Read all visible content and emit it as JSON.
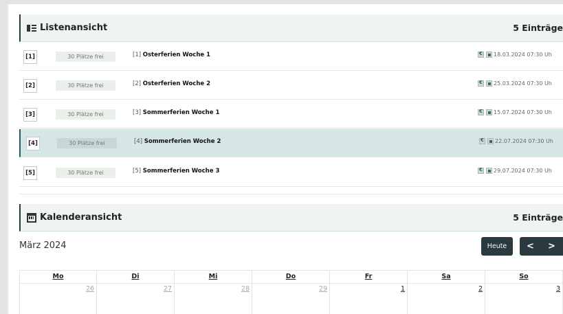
{
  "list_section": {
    "title": "Listenansicht",
    "count": "5 Einträge",
    "rows": [
      {
        "idx": "[1]",
        "places": "30 Plätze frei",
        "num": "[1]",
        "title": "Osterferien Woche 1",
        "date": "18.03.2024 07:30 Uh"
      },
      {
        "idx": "[2]",
        "places": "30 Plätze frei",
        "num": "[2]",
        "title": "Osterferien Woche 2",
        "date": "25.03.2024 07:30 Uh"
      },
      {
        "idx": "[3]",
        "places": "30 Plätze frei",
        "num": "[3]",
        "title": "Sommerferien Woche 1",
        "date": "15.07.2024 07:30 Uh"
      },
      {
        "idx": "[4]",
        "places": "30 Plätze frei",
        "num": "[4]",
        "title": "Sommerferien Woche 2",
        "date": "22.07.2024 07:30 Uh"
      },
      {
        "idx": "[5]",
        "places": "30 Plätze frei",
        "num": "[5]",
        "title": "Sommerferien Woche 3",
        "date": "29.07.2024 07:30 Uh"
      }
    ]
  },
  "calendar_section": {
    "title": "Kalenderansicht",
    "count": "5 Einträge",
    "month": "März 2024",
    "today_label": "Heute",
    "prev_label": "<",
    "next_label": ">",
    "weekdays": [
      "Mo",
      "Di",
      "Mi",
      "Do",
      "Fr",
      "Sa",
      "So"
    ],
    "first_week": [
      "26",
      "27",
      "28",
      "29",
      "1",
      "2",
      "3"
    ]
  },
  "colors": {
    "header_bg": "#eef4f4",
    "active_row_bg": "#d6e6e6",
    "button_bg": "#2b3a3f"
  }
}
